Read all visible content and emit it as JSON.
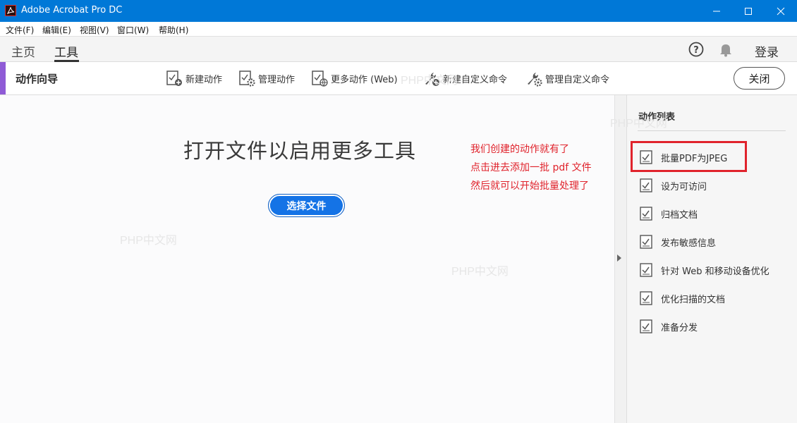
{
  "window": {
    "title": "Adobe Acrobat Pro DC"
  },
  "menu": [
    "文件(F)",
    "编辑(E)",
    "视图(V)",
    "窗口(W)",
    "帮助(H)"
  ],
  "nav": {
    "tabs": [
      "主页",
      "工具"
    ],
    "active_tab": "工具",
    "login": "登录"
  },
  "toolbar": {
    "title": "动作向导",
    "buttons": [
      "新建动作",
      "管理动作",
      "更多动作 (Web)",
      "新建自定义命令",
      "管理自定义命令"
    ],
    "close": "关闭"
  },
  "main": {
    "heading": "打开文件以启用更多工具",
    "select_button": "选择文件",
    "annotation": [
      "我们创建的动作就有了",
      "点击进去添加一批 pdf 文件",
      "然后就可以开始批量处理了"
    ],
    "watermarks": [
      "PHP中文网",
      "PHP中文网",
      "PHP中文网",
      "PHP中文网"
    ]
  },
  "panel": {
    "title": "动作列表",
    "items": [
      "批量PDF为JPEG",
      "设为可访问",
      "归档文档",
      "发布敏感信息",
      "针对 Web 和移动设备优化",
      "优化扫描的文档",
      "准备分发"
    ]
  },
  "colors": {
    "titlebar": "#0078d7",
    "accent": "#8f5bd6",
    "primary_button": "#1473e6",
    "annotation": "#e0232c"
  }
}
